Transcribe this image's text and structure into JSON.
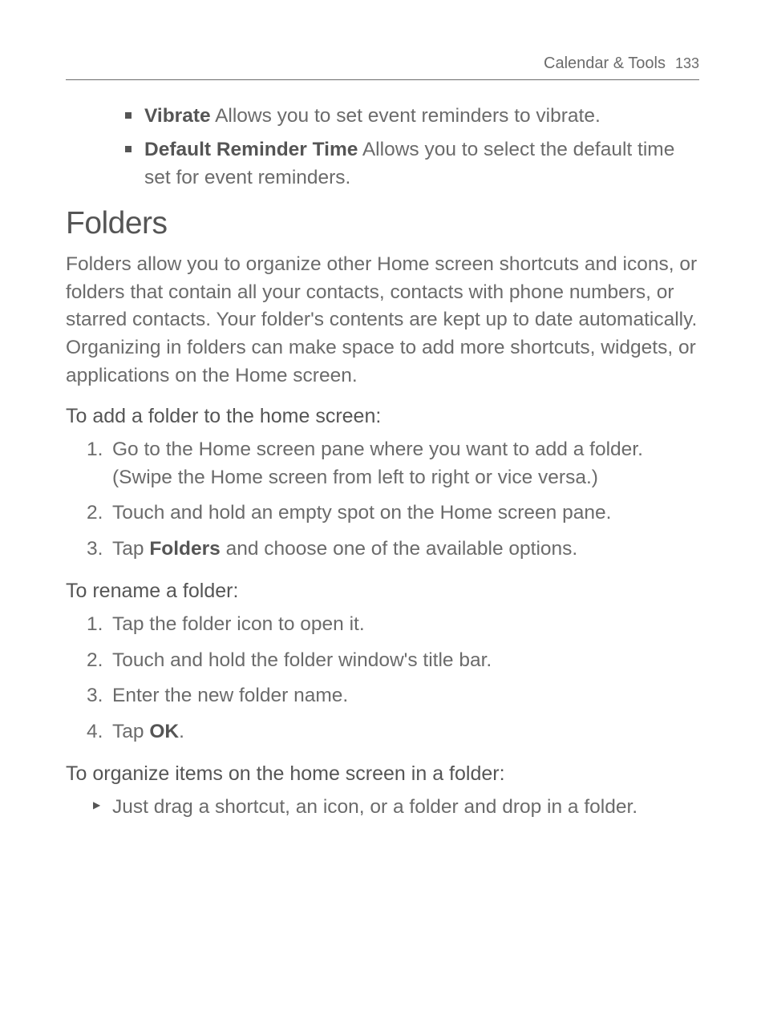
{
  "header": {
    "section": "Calendar & Tools",
    "page": "133"
  },
  "topBullets": [
    {
      "bold": "Vibrate",
      "rest": " Allows you to set event reminders to vibrate."
    },
    {
      "bold": "Default Reminder Time",
      "rest": " Allows you to select the default time set for event reminders."
    }
  ],
  "heading": "Folders",
  "intro": "Folders allow you to organize other Home screen shortcuts and icons, or folders that contain all your contacts, contacts with phone numbers, or starred contacts. Your folder's contents are kept up to date automatically. Organizing in folders can make space to add more shortcuts, widgets, or applications on the Home screen.",
  "sections": [
    {
      "title": "To add a folder to the home screen:",
      "type": "numbered",
      "items": [
        {
          "num": "1.",
          "pre": "Go to the Home screen pane where you want to add a folder. (Swipe the Home screen from left to right or vice versa.)"
        },
        {
          "num": "2.",
          "pre": "Touch and hold an empty spot on the Home screen pane."
        },
        {
          "num": "3.",
          "pre": "Tap ",
          "bold": "Folders",
          "post": " and choose one of the available options."
        }
      ]
    },
    {
      "title": "To rename a folder:",
      "type": "numbered",
      "items": [
        {
          "num": "1.",
          "pre": "Tap the folder icon to open it."
        },
        {
          "num": "2.",
          "pre": "Touch and hold the folder window's title bar."
        },
        {
          "num": "3.",
          "pre": "Enter the new folder name."
        },
        {
          "num": "4.",
          "pre": "Tap ",
          "bold": "OK",
          "post": "."
        }
      ]
    },
    {
      "title": "To organize items on the home screen in a folder:",
      "type": "arrow",
      "items": [
        {
          "pre": "Just drag a shortcut, an icon, or a folder and drop in a folder."
        }
      ]
    }
  ]
}
